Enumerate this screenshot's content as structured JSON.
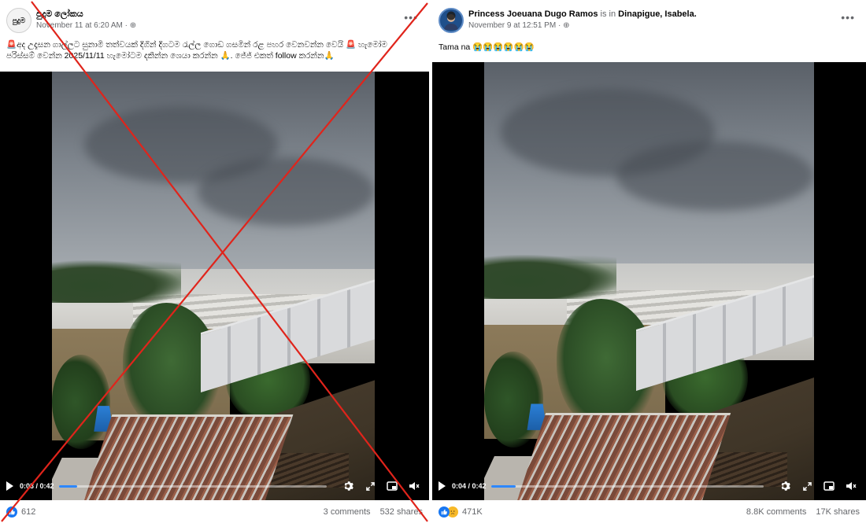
{
  "posts": [
    {
      "author": "පුදුම ලෝකය",
      "author_suffix": "",
      "location": "",
      "timestamp": "November 11 at 6:20 AM · ",
      "caption": "🚨අද උදෑසන ගාල්ලට සුනාමි තත්වයක් දිගින් දිගටම රැල්ල ගොඩ ගසමින් රළ පහර වෙනවන්න වෙයි 🚨 හැමෝම පරිස්සම් වෙන්න 2025/11/11 හැමෝටම දකින්න ශෙයා කරන්න 🙏. ජේජ් එකත් follow කරන්න🙏",
      "video_time": "0:03 / 0:42",
      "video_progress": 0.07,
      "reactions": "612",
      "comments": "3 comments",
      "shares": "532 shares",
      "flagged": true
    },
    {
      "author": "Princess Joeuana Dugo Ramos",
      "author_suffix": " is in ",
      "location": "Dinapigue, Isabela.",
      "timestamp": "November 9 at 12:51 PM · ",
      "caption": "Tama na 😭😭😭😭😭😭",
      "video_time": "0:04 / 0:42",
      "video_progress": 0.09,
      "reactions": "471K",
      "comments": "8.8K comments",
      "shares": "17K shares",
      "flagged": false
    }
  ],
  "icons": {
    "more": "more-options-icon",
    "globe": "globe-icon",
    "play": "play-icon",
    "settings": "gear-icon",
    "expand": "expand-icon",
    "pip": "picture-in-picture-icon",
    "volume": "volume-muted-icon"
  },
  "colors": {
    "accent": "#1877f2",
    "progress": "#2d88ff",
    "cross": "#e0241b"
  }
}
